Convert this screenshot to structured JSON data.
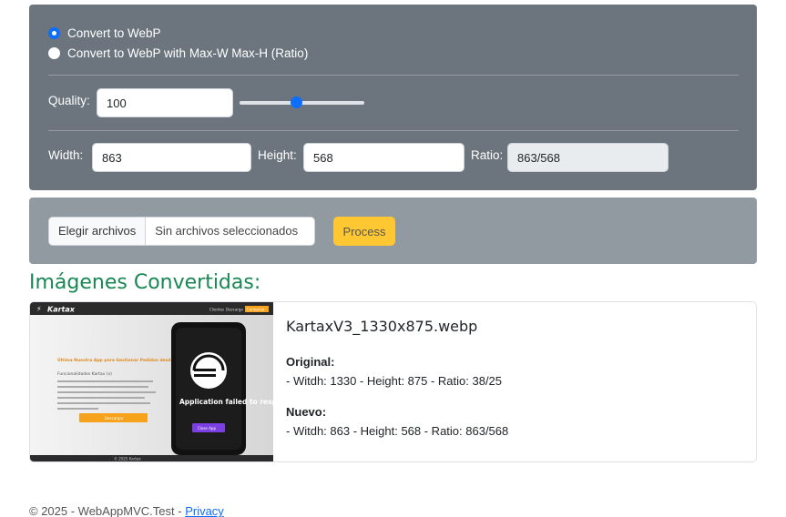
{
  "options": {
    "convert_webp": "Convert to WebP",
    "convert_webp_ratio": "Convert to WebP with Max-W Max-H (Ratio)"
  },
  "quality": {
    "label": "Quality:",
    "value": "100",
    "slider_fraction": 0.45
  },
  "dimensions": {
    "width_label": "Width:",
    "width_value": "863",
    "height_label": "Height:",
    "height_value": "568",
    "ratio_label": "Ratio:",
    "ratio_value": "863/568"
  },
  "upload": {
    "choose_button": "Elegir archivos",
    "no_files_text": "Sin archivos seleccionados",
    "process_button": "Process"
  },
  "results": {
    "title": "Imágenes Convertidas:",
    "items": [
      {
        "file_name": "KartaxV3_1330x875.webp",
        "original_label": "Original:",
        "original_info": "- Witdh: 1330 - Height: 875 - Ratio: 38/25",
        "new_label": "Nuevo:",
        "new_info": "- Witdh: 863 - Height: 568 - Ratio: 863/568",
        "thumbnail": {
          "brand": "Kartax",
          "nav_1": "Clientes",
          "nav_2": "Descarga",
          "nav_cta": "Contactar",
          "headline": "Última Nuestra App para Gestionar Pedidos desde la Mesa del Cliente",
          "features": "Funcionalidades Kartax (v)",
          "cta": "Descargar",
          "phone_text": "Application failed to respond",
          "phone_button": "Close App",
          "footer_text": "© 2025 Kartax"
        }
      }
    ]
  },
  "footer": {
    "text": "© 2025 - WebAppMVC.Test - ",
    "link": "Privacy"
  },
  "colors": {
    "panel_top": "#6c757d",
    "panel_mid": "#919aa1",
    "accent_blue": "#0d6efd",
    "title_green": "#198754",
    "process_yellow": "#ffc832"
  }
}
